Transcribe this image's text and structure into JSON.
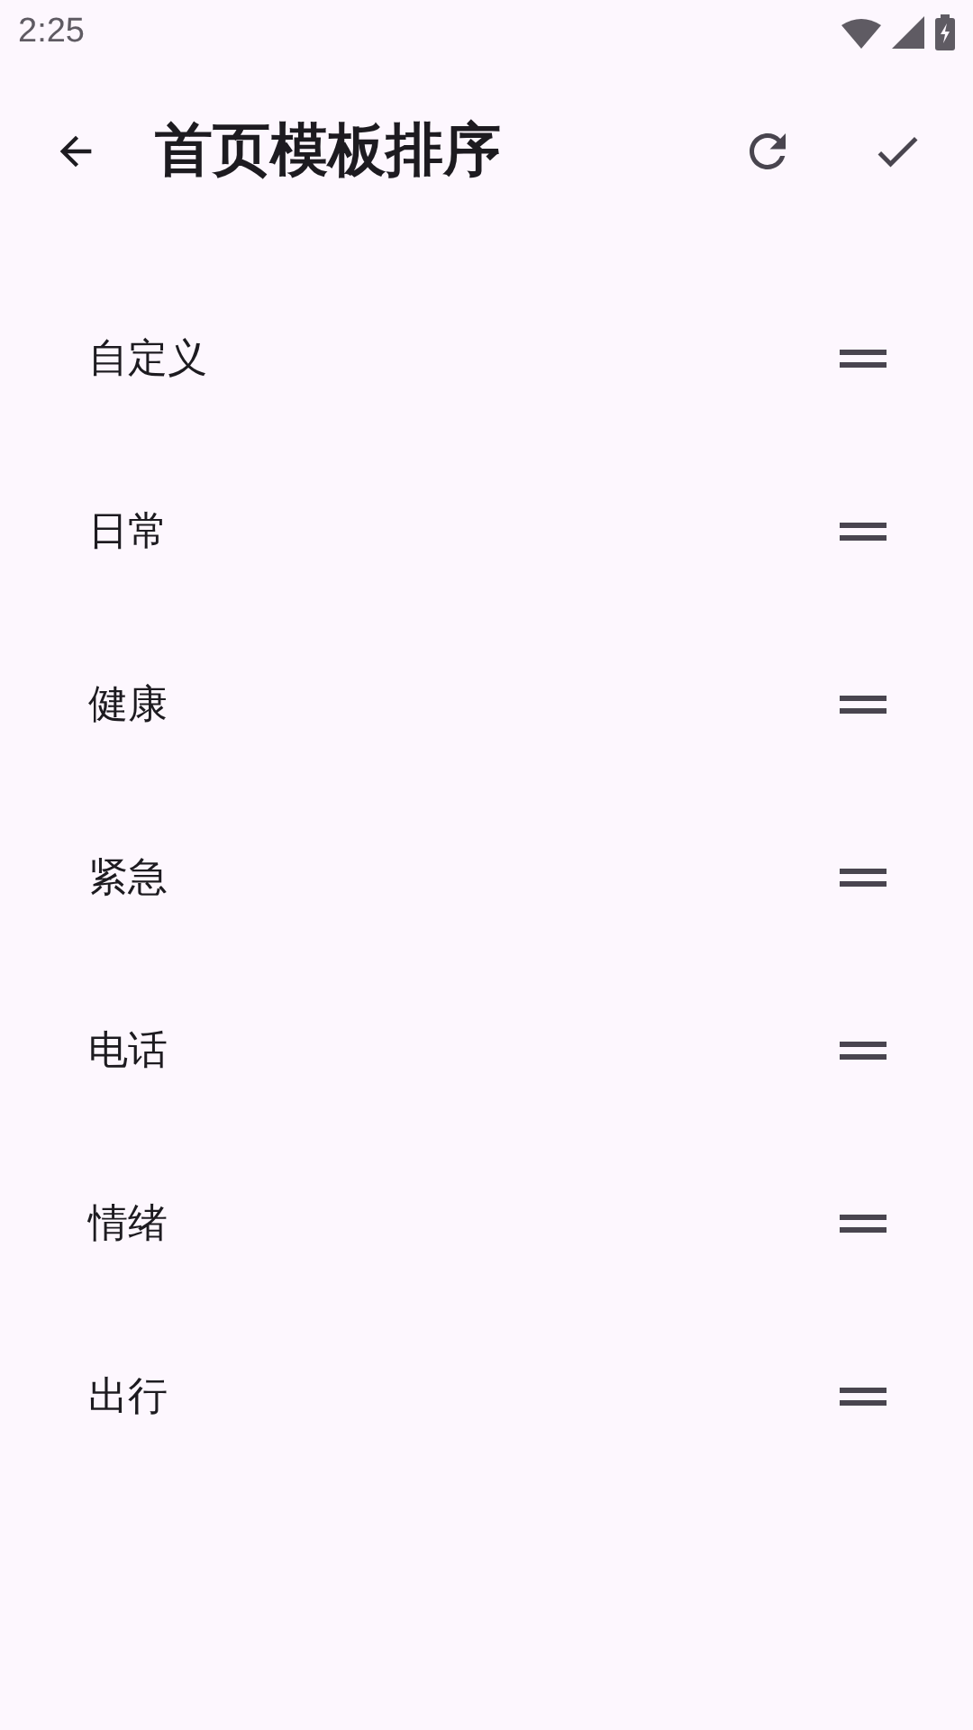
{
  "status_bar": {
    "time": "2:25"
  },
  "app_bar": {
    "title": "首页模板排序"
  },
  "items": [
    {
      "label": "自定义"
    },
    {
      "label": "日常"
    },
    {
      "label": "健康"
    },
    {
      "label": "紧急"
    },
    {
      "label": "电话"
    },
    {
      "label": "情绪"
    },
    {
      "label": "出行"
    }
  ]
}
